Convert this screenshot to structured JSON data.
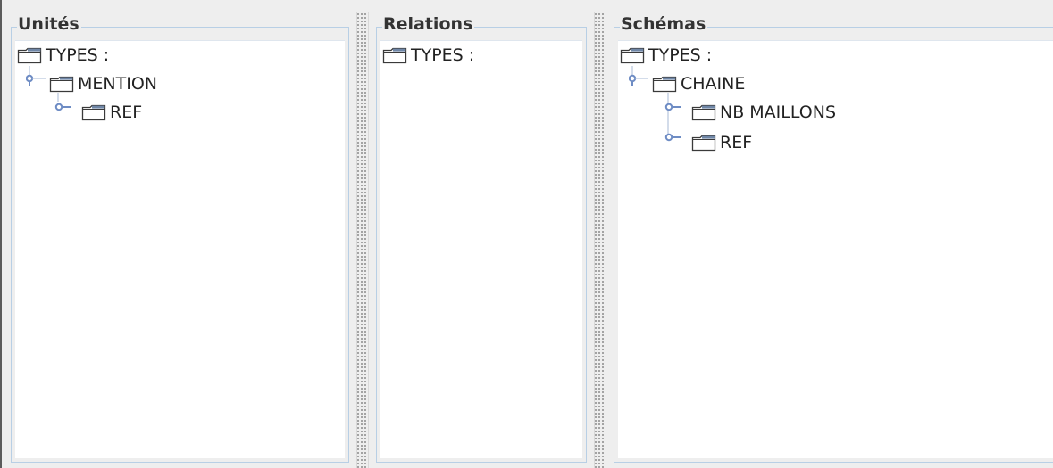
{
  "panels": [
    {
      "title": "Unités",
      "root": "TYPES :",
      "children": [
        {
          "label": "MENTION",
          "children": [
            {
              "label": "REF"
            }
          ]
        }
      ]
    },
    {
      "title": "Relations",
      "root": "TYPES :",
      "children": []
    },
    {
      "title": "Schémas",
      "root": "TYPES :",
      "children": [
        {
          "label": "CHAINE",
          "children": [
            {
              "label": "NB MAILLONS"
            },
            {
              "label": "REF"
            }
          ]
        }
      ]
    }
  ],
  "colors": {
    "border": "#b8cfe5",
    "handle": "#6e8cc4",
    "folder_stroke": "#3a3a3a",
    "folder_fill": "#ffffff",
    "folder_tab": "#6f86a6"
  }
}
